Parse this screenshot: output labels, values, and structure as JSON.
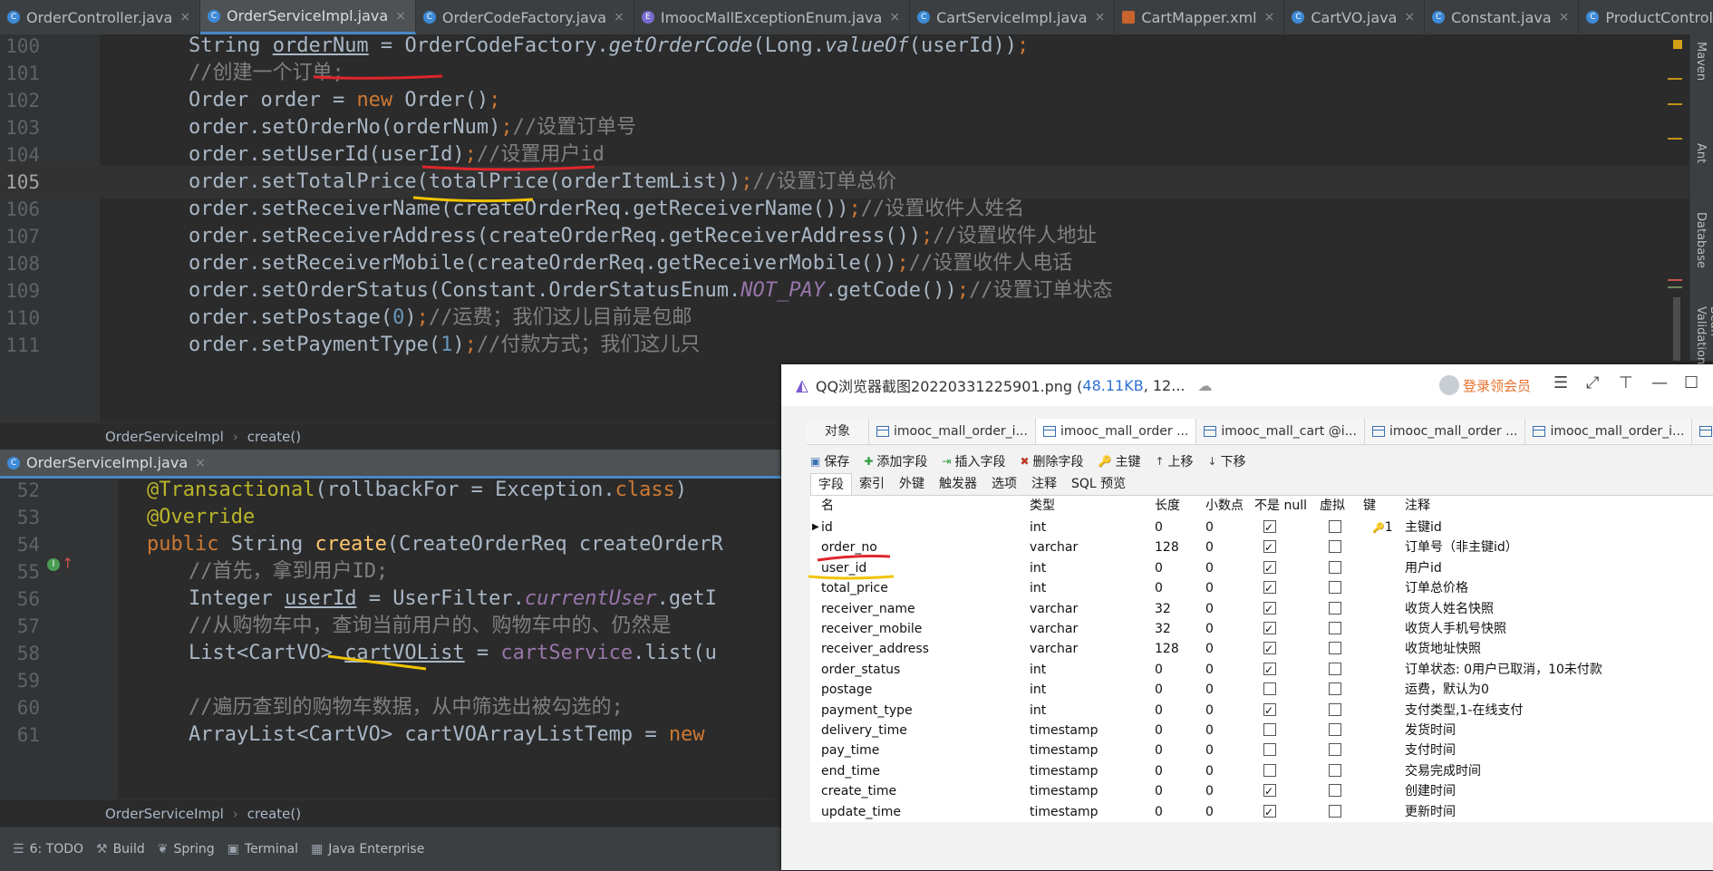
{
  "tabs": [
    {
      "label": "OrderController.java",
      "icon": "c"
    },
    {
      "label": "OrderServiceImpl.java",
      "icon": "c",
      "active": true
    },
    {
      "label": "OrderCodeFactory.java",
      "icon": "c"
    },
    {
      "label": "ImoocMallExceptionEnum.java",
      "icon": "e"
    },
    {
      "label": "CartServiceImpl.java",
      "icon": "c"
    },
    {
      "label": "CartMapper.xml",
      "icon": "x"
    },
    {
      "label": "CartVO.java",
      "icon": "c"
    },
    {
      "label": "Constant.java",
      "icon": "c"
    },
    {
      "label": "ProductController.java",
      "icon": "c"
    }
  ],
  "tab_close": "×",
  "right_tools": [
    "Maven",
    "Ant",
    "Database",
    "Bean Validation"
  ],
  "editor_top": {
    "lines": [
      {
        "n": "100",
        "parts": [
          [
            "",
            "String "
          ],
          [
            "ul",
            "orderNum"
          ],
          [
            "",
            " = "
          ],
          [
            "",
            "OrderCodeFactory."
          ],
          [
            "it",
            "getOrderCode"
          ],
          [
            "",
            "(Long."
          ],
          [
            "it",
            "valueOf"
          ],
          [
            "",
            "(userId))"
          ],
          [
            "kw",
            ";"
          ]
        ]
      },
      {
        "n": "101",
        "parts": [
          [
            "cm",
            "//创建一个订单;"
          ]
        ]
      },
      {
        "n": "102",
        "parts": [
          [
            "",
            "Order order = "
          ],
          [
            "kw",
            "new "
          ],
          [
            "",
            "Order()"
          ],
          [
            "kw",
            ";"
          ]
        ]
      },
      {
        "n": "103",
        "parts": [
          [
            "",
            "order.setOrderNo(orderNum)"
          ],
          [
            "kw",
            ";"
          ],
          [
            "cm",
            "//设置订单号"
          ]
        ]
      },
      {
        "n": "104",
        "parts": [
          [
            "",
            "order.setUserId(userId)"
          ],
          [
            "kw",
            ";"
          ],
          [
            "cm",
            "//设置用户id"
          ]
        ]
      },
      {
        "n": "105",
        "parts": [
          [
            "",
            "order.setTotalPrice(totalPrice(orderItemList))"
          ],
          [
            "kw",
            ";"
          ],
          [
            "cm",
            "//设置订单总价"
          ]
        ]
      },
      {
        "n": "106",
        "parts": [
          [
            "",
            "order.setReceiverName(createOrderReq.getReceiverName())"
          ],
          [
            "kw",
            ";"
          ],
          [
            "cm",
            "//设置收件人姓名"
          ]
        ]
      },
      {
        "n": "107",
        "parts": [
          [
            "",
            "order.setReceiverAddress(createOrderReq.getReceiverAddress())"
          ],
          [
            "kw",
            ";"
          ],
          [
            "cm",
            "//设置收件人地址"
          ]
        ]
      },
      {
        "n": "108",
        "parts": [
          [
            "",
            "order.setReceiverMobile(createOrderReq.getReceiverMobile())"
          ],
          [
            "kw",
            ";"
          ],
          [
            "cm",
            "//设置收件人电话"
          ]
        ]
      },
      {
        "n": "109",
        "parts": [
          [
            "",
            "order.setOrderStatus(Constant.OrderStatusEnum."
          ],
          [
            "st",
            "NOT_PAY"
          ],
          [
            "",
            ".getCode())"
          ],
          [
            "kw",
            ";"
          ],
          [
            "cm",
            "//设置订单状态"
          ]
        ]
      },
      {
        "n": "110",
        "parts": [
          [
            "",
            "order.setPostage("
          ],
          [
            "nm",
            "0"
          ],
          [
            "",
            ")"
          ],
          [
            "kw",
            ";"
          ],
          [
            "cm",
            "//运费；我们这儿目前是包邮"
          ]
        ]
      },
      {
        "n": "111",
        "parts": [
          [
            "",
            "order.setPaymentType("
          ],
          [
            "nm",
            "1"
          ],
          [
            "",
            ")"
          ],
          [
            "kw",
            ";"
          ],
          [
            "cm",
            "//付款方式；我们这儿只"
          ]
        ]
      }
    ],
    "breadcrumb": [
      "OrderServiceImpl",
      "create()"
    ]
  },
  "editor_bottom": {
    "tab_label": "OrderServiceImpl.java",
    "lines": [
      {
        "n": "52",
        "parts": [
          [
            "an",
            "@Transactional"
          ],
          [
            "",
            "(rollbackFor = Exception."
          ],
          [
            "kw",
            "class"
          ],
          [
            "",
            ")"
          ]
        ]
      },
      {
        "n": "53",
        "parts": [
          [
            "an",
            "@Override"
          ]
        ]
      },
      {
        "n": "54",
        "parts": [
          [
            "kw",
            "public "
          ],
          [
            "",
            "String "
          ],
          [
            "fn",
            "create"
          ],
          [
            "",
            "(CreateOrderReq createOrderR"
          ]
        ]
      },
      {
        "n": "55",
        "parts": [
          [
            "cm",
            "//首先，拿到用户ID;"
          ]
        ]
      },
      {
        "n": "56",
        "parts": [
          [
            "",
            "Integer "
          ],
          [
            "ul",
            "userId"
          ],
          [
            "",
            " = UserFilter."
          ],
          [
            "st",
            "currentUser"
          ],
          [
            "",
            ".getI"
          ]
        ]
      },
      {
        "n": "57",
        "parts": [
          [
            "cm",
            "//从购物车中，查询当前用户的、购物车中的、仍然是"
          ]
        ]
      },
      {
        "n": "58",
        "parts": [
          [
            "",
            "List<CartVO> "
          ],
          [
            "ul",
            "cartVOList"
          ],
          [
            "",
            " = "
          ],
          [
            "fld",
            "cartService"
          ],
          [
            "",
            ".list(u"
          ]
        ]
      },
      {
        "n": "59",
        "parts": []
      },
      {
        "n": "60",
        "parts": [
          [
            "cm",
            "//遍历查到的购物车数据，从中筛选出被勾选的;"
          ]
        ]
      },
      {
        "n": "61",
        "parts": [
          [
            "",
            "ArrayList<CartVO> cartVOArrayListTemp = "
          ],
          [
            "kw",
            "new"
          ]
        ]
      }
    ],
    "breadcrumb": [
      "OrderServiceImpl",
      "create()"
    ]
  },
  "bottom_tools": [
    {
      "label": "6: TODO",
      "icon": "☰"
    },
    {
      "label": "Build",
      "icon": "⚒"
    },
    {
      "label": "Spring",
      "icon": "❦"
    },
    {
      "label": "Terminal",
      "icon": "▣"
    },
    {
      "label": "Java Enterprise",
      "icon": "▦"
    }
  ],
  "viewer": {
    "title": "QQ浏览器截图20220331225901.png (",
    "size": "48.11KB",
    "title_rest": ", 12...",
    "vip_label": "登录领会员",
    "nav_label": "对象",
    "nav_tabs": [
      "imooc_mall_order_i...",
      "imooc_mall_order ...",
      "imooc_mall_cart @i...",
      "imooc_mall_order ...",
      "imooc_mall_order_i...",
      "imooc_ma"
    ],
    "toolbar": [
      {
        "label": "保存",
        "icon": "▣",
        "color": "#3a6fb0"
      },
      {
        "label": "添加字段",
        "icon": "✚",
        "color": "#2e9e3e"
      },
      {
        "label": "插入字段",
        "icon": "⇥",
        "color": "#2e9e3e"
      },
      {
        "label": "删除字段",
        "icon": "✖",
        "color": "#c0392b"
      },
      {
        "label": "主键",
        "icon": "🔑",
        "color": "#d4a017"
      },
      {
        "label": "上移",
        "icon": "↑",
        "color": "#444"
      },
      {
        "label": "下移",
        "icon": "↓",
        "color": "#444"
      }
    ],
    "subtabs": [
      "字段",
      "索引",
      "外键",
      "触发器",
      "选项",
      "注释",
      "SQL 预览"
    ],
    "columns": [
      "名",
      "类型",
      "长度",
      "小数点",
      "不是 null",
      "虚拟",
      "键",
      "注释"
    ],
    "rows": [
      {
        "name": "id",
        "type": "int",
        "len": "0",
        "dec": "0",
        "nn": true,
        "virt": false,
        "key": "1",
        "comment": "主键id"
      },
      {
        "name": "order_no",
        "type": "varchar",
        "len": "128",
        "dec": "0",
        "nn": true,
        "virt": false,
        "key": "",
        "comment": "订单号（非主键id）"
      },
      {
        "name": "user_id",
        "type": "int",
        "len": "0",
        "dec": "0",
        "nn": true,
        "virt": false,
        "key": "",
        "comment": "用户id"
      },
      {
        "name": "total_price",
        "type": "int",
        "len": "0",
        "dec": "0",
        "nn": true,
        "virt": false,
        "key": "",
        "comment": "订单总价格"
      },
      {
        "name": "receiver_name",
        "type": "varchar",
        "len": "32",
        "dec": "0",
        "nn": true,
        "virt": false,
        "key": "",
        "comment": "收货人姓名快照"
      },
      {
        "name": "receiver_mobile",
        "type": "varchar",
        "len": "32",
        "dec": "0",
        "nn": true,
        "virt": false,
        "key": "",
        "comment": "收货人手机号快照"
      },
      {
        "name": "receiver_address",
        "type": "varchar",
        "len": "128",
        "dec": "0",
        "nn": true,
        "virt": false,
        "key": "",
        "comment": "收货地址快照"
      },
      {
        "name": "order_status",
        "type": "int",
        "len": "0",
        "dec": "0",
        "nn": true,
        "virt": false,
        "key": "",
        "comment": "订单状态: 0用户已取消，10未付款"
      },
      {
        "name": "postage",
        "type": "int",
        "len": "0",
        "dec": "0",
        "nn": false,
        "virt": false,
        "key": "",
        "comment": "运费，默认为0"
      },
      {
        "name": "payment_type",
        "type": "int",
        "len": "0",
        "dec": "0",
        "nn": true,
        "virt": false,
        "key": "",
        "comment": "支付类型,1-在线支付"
      },
      {
        "name": "delivery_time",
        "type": "timestamp",
        "len": "0",
        "dec": "0",
        "nn": false,
        "virt": false,
        "key": "",
        "comment": "发货时间"
      },
      {
        "name": "pay_time",
        "type": "timestamp",
        "len": "0",
        "dec": "0",
        "nn": false,
        "virt": false,
        "key": "",
        "comment": "支付时间"
      },
      {
        "name": "end_time",
        "type": "timestamp",
        "len": "0",
        "dec": "0",
        "nn": false,
        "virt": false,
        "key": "",
        "comment": "交易完成时间"
      },
      {
        "name": "create_time",
        "type": "timestamp",
        "len": "0",
        "dec": "0",
        "nn": true,
        "virt": false,
        "key": "",
        "comment": "创建时间"
      },
      {
        "name": "update_time",
        "type": "timestamp",
        "len": "0",
        "dec": "0",
        "nn": true,
        "virt": false,
        "key": "",
        "comment": "更新时间"
      }
    ]
  }
}
